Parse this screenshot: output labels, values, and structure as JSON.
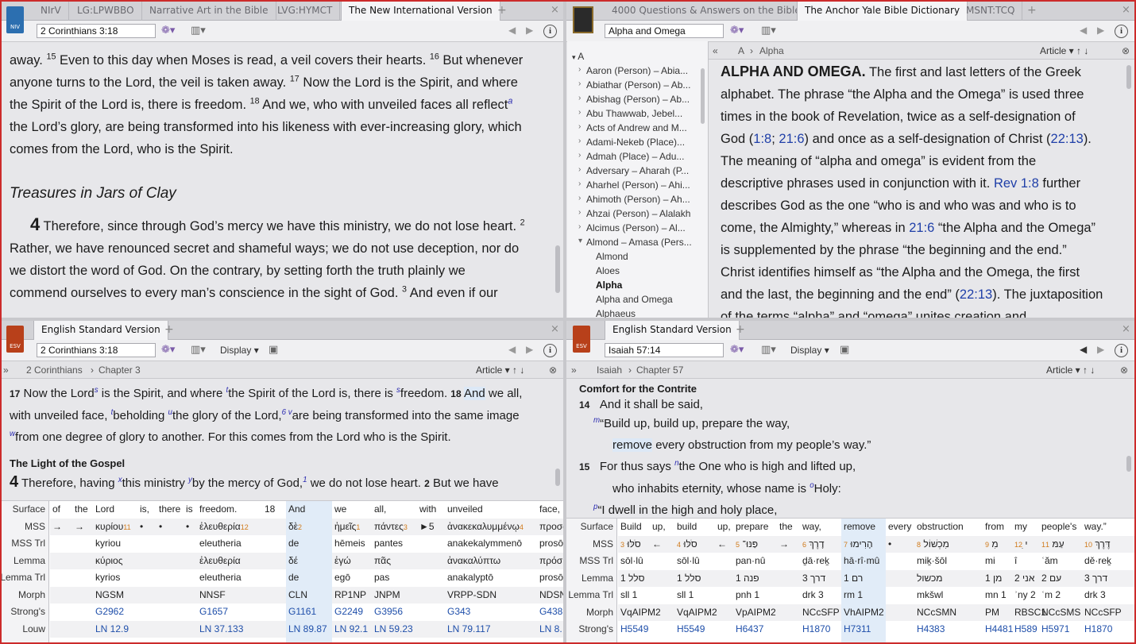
{
  "tl": {
    "tabs": [
      "NIrV",
      "LG:LPWBBO",
      "Narrative Art in the Bible",
      "LVG:HYMCT",
      "The New International Version"
    ],
    "badge": "NIV",
    "reference": "2 Corinthians 3:18",
    "p1": [
      "away.",
      "15",
      " Even to this day when Moses is read, a veil covers their hearts. ",
      "16",
      " But whenever"
    ],
    "p2": "anyone turns to the Lord, the veil is taken away.",
    "p2v": "17",
    "p2b": " Now the Lord is the Spirit, and where",
    "p3": "the Spirit of the Lord is, there is freedom.",
    "p3v": "18",
    "p3b": " And we, who with unveiled faces all reflect",
    "p3fn": "a",
    "p4": "the Lord’s glory, are being transformed into his likeness with ever-increasing glory, which",
    "p5": "comes from the Lord, who is the Spirit.",
    "heading": "Treasures in Jars of Clay",
    "chap": "4",
    "c1": "  Therefore, since through God’s mercy we have this ministry, we do not lose heart.",
    "c1v": "2",
    "c2": "Rather, we have renounced secret and shameful ways; we do not use deception, nor do",
    "c3": "we distort the word of God. On the contrary, by setting forth the truth plainly we",
    "c4": "commend ourselves to every man’s conscience in the sight of God.",
    "c4v": "3",
    "c4b": " And even if our"
  },
  "tr": {
    "tabs": [
      "4000 Questions & Answers on the Bible",
      "The Anchor Yale Bible Dictionary",
      "MSNT:TCQ"
    ],
    "search": "Alpha and Omega",
    "crumb_a": "A",
    "crumb_b": "Alpha",
    "article": "Article",
    "tree_root": "A",
    "tree": [
      "Aaron (Person) – Abia...",
      "Abiathar (Person) – Ab...",
      "Abishag (Person) – Ab...",
      "Abu Thawwab, Jebel...",
      "Acts of Andrew and M...",
      "Adami-Nekeb (Place)...",
      "Admah (Place) – Adu...",
      "Adversary – Aharah (P...",
      "Aharhel (Person) – Ahi...",
      "Ahimoth (Person) – Ah...",
      "Ahzai (Person) – Alalakh",
      "Alcimus (Person) – Al...",
      "Almond – Amasa (Pers..."
    ],
    "subtree": [
      "Almond",
      "Aloes",
      "Alpha",
      "Alpha and Omega",
      "Alphaeus"
    ],
    "title": "ALPHA AND OMEGA.",
    "l1": " The first and last letters of the Greek",
    "l2": "alphabet. The phrase “the Alpha and the Omega” is used three",
    "l3": "times in the book of Revelation, twice as a self-designation of",
    "l4a": "God (",
    "l4r1": "1:8",
    "l4s": "; ",
    "l4r2": "21:6",
    "l4b": ") and once as a self-designation of Christ (",
    "l4r3": "22:13",
    "l4c": ").",
    "l5": "The meaning of “alpha and omega” is evident from the",
    "l6a": "descriptive phrases used in conjunction with it. ",
    "l6r": "Rev 1:8",
    "l6b": " further",
    "l7": "describes God as the one “who is and who was and who is to",
    "l8a": "come, the Almighty,” whereas in ",
    "l8r": "21:6",
    "l8b": " “the Alpha and the Omega”",
    "l9": "is supplemented by the phrase “the beginning and the end.”",
    "l10": "Christ identifies himself as “the Alpha and the Omega, the first",
    "l11a": "and the last, the beginning and the end” (",
    "l11r": "22:13",
    "l11b": "). The juxtaposition",
    "l12": "of the terms “alpha” and “omega” unites creation and"
  },
  "bl": {
    "tab": "English Standard Version",
    "badge": "ESV",
    "reference": "2 Corinthians 3:18",
    "display": "Display",
    "crumb_a": "2 Corinthians",
    "crumb_b": "Chapter 3",
    "article": "Article",
    "v17": "17",
    "t1a": " Now the Lord",
    "t1f1": "s",
    "t1b": " is the Spirit, and where ",
    "t1f2": "t",
    "t1c": "the Spirit of the Lord is, there is ",
    "t1f3": "s",
    "t1d": "freedom. ",
    "v18": "18",
    "t1e": "And",
    "t1g": " we all,",
    "t2a": "with unveiled face, ",
    "t2f1": "t",
    "t2b": "beholding ",
    "t2f2": "u",
    "t2c": "the glory of the Lord,",
    "t2f3": "6 v",
    "t2d": "are being transformed into the same image",
    "t3f": "w",
    "t3": "from one degree of glory to another. For this comes from the Lord who is the Spirit.",
    "heading": "The Light of the Gospel",
    "chap": "4",
    "t4a": " Therefore, having ",
    "t4f1": "x",
    "t4b": "this ministry ",
    "t4f2": "y",
    "t4c": "by the mercy of God,",
    "t4f3": "1",
    "t4d": " we do not lose heart. ",
    "t4v": "2",
    "t4e": " But we have",
    "labels": [
      "Surface",
      "MSS",
      "MSS Trl",
      "Lemma",
      "Lemma Trl",
      "Morph",
      "Strong's",
      "Louw"
    ],
    "cols": [
      {
        "s": "of",
        "m": "→"
      },
      {
        "s": "the",
        "m": "→"
      },
      {
        "s": "Lord",
        "m": "κυρίου",
        "n": "11",
        "mt": "kyriou",
        "l": "κύριος",
        "lt": "kyrios",
        "mo": "NGSM",
        "st": "G2962",
        "lo": "LN 12.9"
      },
      {
        "s": "is,",
        "m": "•"
      },
      {
        "s": "there",
        "m": "•"
      },
      {
        "s": "is",
        "m": "•"
      },
      {
        "s": "freedom.",
        "m": "ἐλευθερία",
        "n": "12",
        "mt": "eleutheria",
        "l": "ἐλευθερία",
        "lt": "eleutheria",
        "mo": "NNSF",
        "st": "G1657",
        "lo": "LN 37.133"
      },
      {
        "s": "18",
        "m": ""
      },
      {
        "s": "And",
        "m": "δὲ",
        "n": "2",
        "mt": "de",
        "l": "δέ",
        "lt": "de",
        "mo": "CLN",
        "st": "G1161",
        "lo": "LN 89.87"
      },
      {
        "s": "we",
        "m": "ἡμεῖς",
        "n": "1",
        "mt": "hēmeis",
        "l": "ἐγώ",
        "lt": "egō",
        "mo": "RP1NP",
        "st": "G2249",
        "lo": "LN 92.1"
      },
      {
        "s": "all,",
        "m": "πάντες",
        "n": "3",
        "mt": "pantes",
        "l": "πᾶς",
        "lt": "pas",
        "mo": "JNPM",
        "st": "G3956",
        "lo": "LN 59.23"
      },
      {
        "s": "with",
        "m": "►5"
      },
      {
        "s": "unveiled",
        "m": "ἀνακεκαλυμμένῳ",
        "n": "4",
        "mt": "anakekalymmenō",
        "l": "ἀνακαλύπτω",
        "lt": "anakalyptō",
        "mo": "VRPP-SDN",
        "st": "G343",
        "lo": "LN 79.117"
      },
      {
        "s": "face,",
        "m": "προσώ",
        "mt": "prosō",
        "l": "πρόσ",
        "lt": "prosō",
        "mo": "NDSN",
        "st": "G4383",
        "lo": "LN 8."
      }
    ]
  },
  "br": {
    "tab": "English Standard Version",
    "badge": "ESV",
    "reference": "Isaiah 57:14",
    "display": "Display",
    "crumb_a": "Isaiah",
    "crumb_b": "Chapter 57",
    "article": "Article",
    "heading": "Comfort for the Contrite",
    "v14": "14",
    "a1": "And it shall be said,",
    "a2f": "m",
    "a2": "“Build up, build up, prepare the way,",
    "a3h": "remove",
    "a3": " every obstruction from my people’s way.”",
    "v15": "15",
    "b1a": "For thus says ",
    "b1f": "n",
    "b1b": "the One who is high and lifted up,",
    "b2a": "who inhabits eternity, whose name is ",
    "b2f": "o",
    "b2b": "Holy:",
    "b3f": "p",
    "b3": "“I dwell in the high and holy place,",
    "labels": [
      "Surface",
      "MSS",
      "MSS Trl",
      "Lemma",
      "Lemma Trl",
      "Morph",
      "Strong's"
    ],
    "cols": [
      {
        "s": "Build",
        "m": "סֹלּוּ",
        "n": "3",
        "mt": "sōl·lû",
        "l": "סלל",
        "ln": "1",
        "lt": "sll 1",
        "mo": "VqAIPM2",
        "st": "H5549"
      },
      {
        "s": "up,",
        "m": "←"
      },
      {
        "s": "build",
        "m": "סֹלּוּ",
        "n": "4",
        "mt": "sōl·lû",
        "l": "סלל",
        "ln": "1",
        "lt": "sll 1",
        "mo": "VqAIPM2",
        "st": "H5549"
      },
      {
        "s": "up,",
        "m": "←"
      },
      {
        "s": "prepare",
        "m": "פַּנּוּ־",
        "n": "5",
        "mt": "pan·nû",
        "l": "פנה",
        "ln": "1",
        "lt": "pnh 1",
        "mo": "VpAIPM2",
        "st": "H6437"
      },
      {
        "s": "the",
        "m": "→"
      },
      {
        "s": "way,",
        "m": "דָרֶךְ",
        "n": "6",
        "mt": "ḏā·reḵ",
        "l": "דרך",
        "ln": "3",
        "lt": "drk 3",
        "mo": "NCcSFP",
        "st": "H1870"
      },
      {
        "s": "remove",
        "m": "הָרִימוּ",
        "n": "7",
        "mt": "hā·rî·mû",
        "l": "רם",
        "ln": "1",
        "lt": "rm 1",
        "mo": "VhAIPM2",
        "st": "H7311"
      },
      {
        "s": "every",
        "m": "•"
      },
      {
        "s": "obstruction",
        "m": "מִכְשׁוֹל",
        "n": "8",
        "mt": "miḵ·šōl",
        "l": "מכשול",
        "lt": "mkšwl",
        "mo": "NCcSMN",
        "st": "H4383"
      },
      {
        "s": "from",
        "m": "מִ",
        "n": "9",
        "mt": "mi",
        "l": "מן",
        "ln": "1",
        "lt": "mn 1",
        "mo": "PM",
        "st": "H4481"
      },
      {
        "s": "my",
        "m": "ִי",
        "n": "12",
        "mt": "î",
        "l": "אני",
        "ln": "2",
        "lt": "ʾny 2",
        "mo": "RBSC1",
        "st": "H589"
      },
      {
        "s": "people's",
        "m": "עַמּ",
        "n": "11",
        "mt": "ʿăm",
        "l": "עם",
        "ln": "2",
        "lt": "ʿm 2",
        "mo": "NCcSMS",
        "st": "H5971"
      },
      {
        "s": "way.”",
        "m": "דֶּרֶךְ",
        "n": "10",
        "mt": "dě·reḵ",
        "l": "דרך",
        "ln": "3",
        "lt": "drk 3",
        "mo": "NCcSFP",
        "st": "H1870"
      }
    ]
  }
}
